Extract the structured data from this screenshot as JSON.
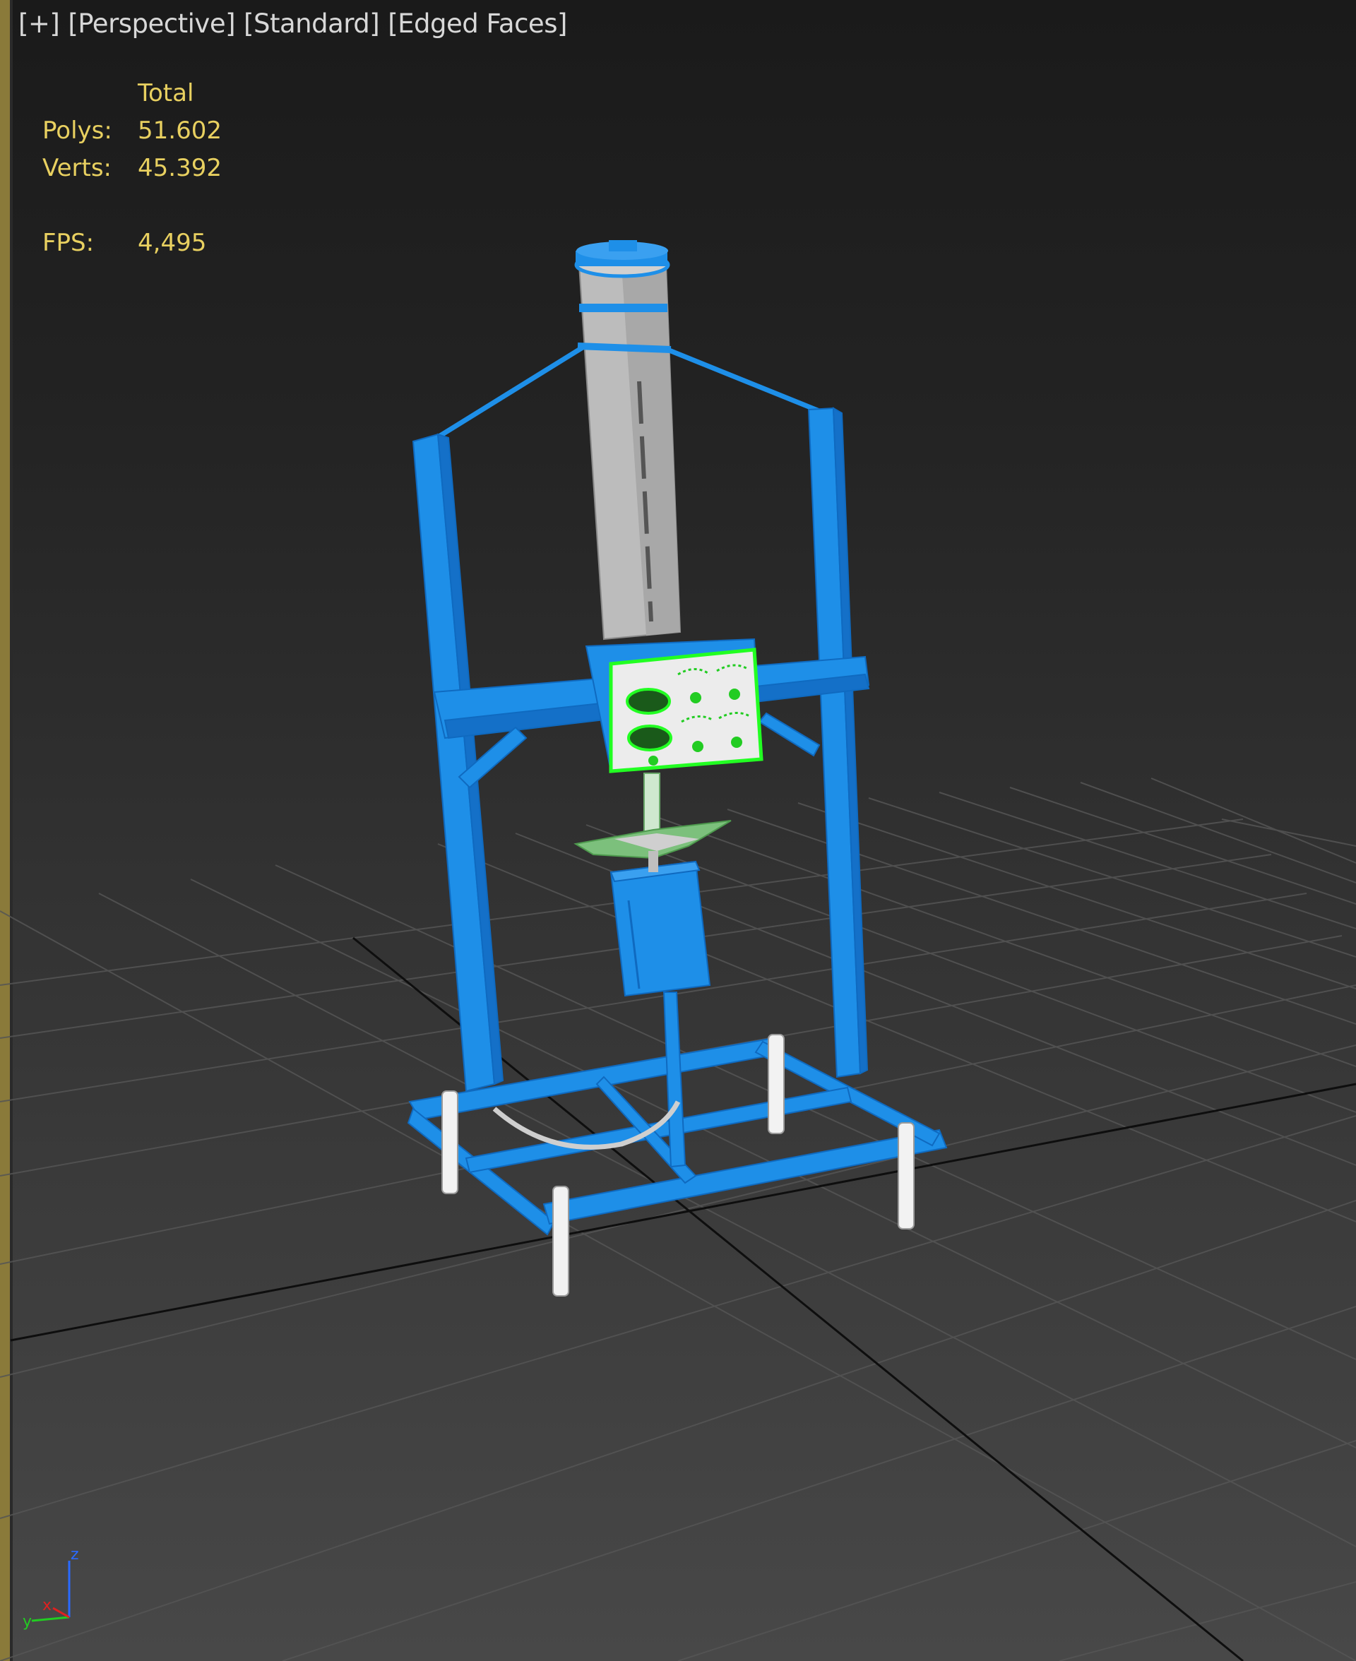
{
  "viewport": {
    "labels": [
      "[+]",
      "[Perspective]",
      "[Standard]",
      "[Edged Faces]"
    ]
  },
  "stats": {
    "header": "Total",
    "polys_label": "Polys:",
    "polys_value": "51.602",
    "verts_label": "Verts:",
    "verts_value": "45.392",
    "fps_label": "FPS:",
    "fps_value": "4,495"
  },
  "gizmo": {
    "z": "z",
    "x": "x",
    "y": "y"
  },
  "colors": {
    "stat_text": "#e8d060",
    "frame_blue": "#1e8fe8",
    "selected_green": "#22ff22",
    "cylinder_gray": "#bdbdbd",
    "grid_line": "#5a5a5a",
    "axis_black": "#111111"
  }
}
